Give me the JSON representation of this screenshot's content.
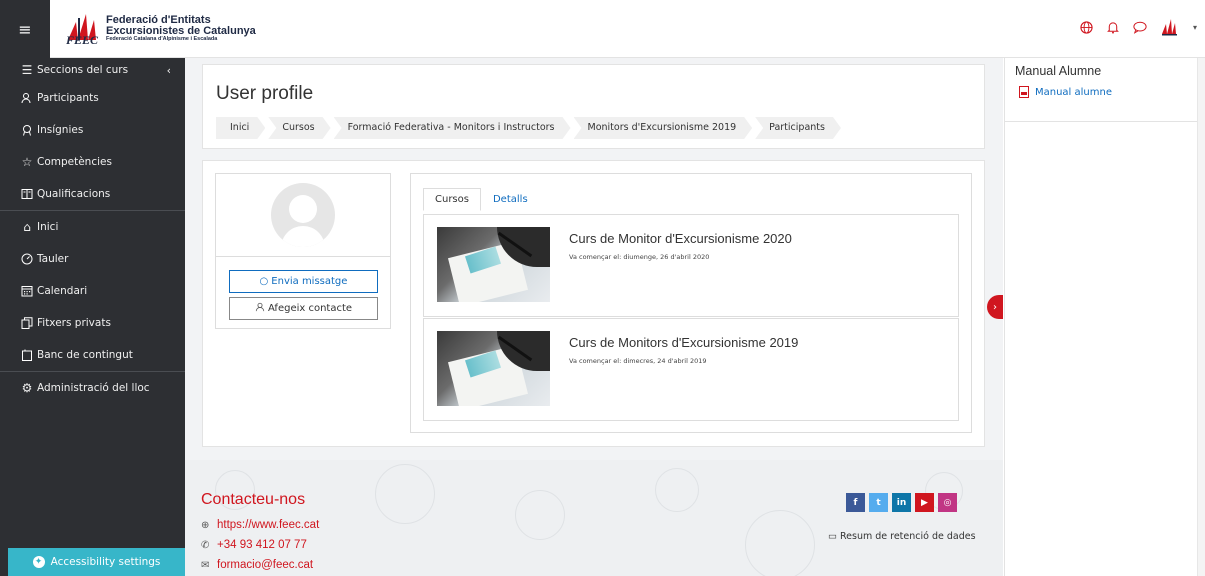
{
  "brand": {
    "line1": "Federació d'Entitats",
    "line2": "Excursionistes de Catalunya",
    "line3": "Federació Catalana d'Alpinisme i Escalada",
    "short": "FEEC",
    "accent": "#d0161f"
  },
  "topbar_icons": [
    "globe-icon",
    "bell-icon",
    "chat-icon",
    "user-menu-logo-icon",
    "caret-down-icon"
  ],
  "sidebar": {
    "items": [
      {
        "label": "Seccions del curs",
        "icon": "list-icon"
      },
      {
        "label": "Participants",
        "icon": "users-icon"
      },
      {
        "label": "Insígnies",
        "icon": "badge-icon"
      },
      {
        "label": "Competències",
        "icon": "star-icon"
      },
      {
        "label": "Qualificacions",
        "icon": "gradebook-icon"
      },
      {
        "label": "Inici",
        "icon": "home-icon"
      },
      {
        "label": "Tauler",
        "icon": "dashboard-icon"
      },
      {
        "label": "Calendari",
        "icon": "calendar-icon"
      },
      {
        "label": "Fitxers privats",
        "icon": "files-icon"
      },
      {
        "label": "Banc de contingut",
        "icon": "content-bank-icon"
      },
      {
        "label": "Administració del lloc",
        "icon": "gear-icon"
      }
    ],
    "accessibility": "Accessibility settings"
  },
  "header": {
    "title": "User profile",
    "breadcrumb": [
      "Inici",
      "Cursos",
      "Formació Federativa - Monitors i Instructors",
      "Monitors d'Excursionisme 2019",
      "Participants"
    ]
  },
  "profile": {
    "message_button": "Envia missatge",
    "contact_button": "Afegeix contacte",
    "tabs": [
      "Cursos",
      "Detalls"
    ],
    "courses": [
      {
        "title": "Curs de Monitor d'Excursionisme 2020",
        "meta": "Va començar el: diumenge, 26 d'abril 2020"
      },
      {
        "title": "Curs de Monitors d'Excursionisme 2019",
        "meta": "Va començar el: dimecres, 24 d'abril 2019"
      }
    ]
  },
  "footer": {
    "contact_title": "Contacteu-nos",
    "web": "https://www.feec.cat",
    "phone": "+34 93 412 07 77",
    "email": "formacio@feec.cat",
    "retention": "Resum de retenció de dades",
    "socials": [
      {
        "name": "facebook",
        "glyph": "f",
        "color": "#3b5998"
      },
      {
        "name": "twitter",
        "glyph": "t",
        "color": "#55acee"
      },
      {
        "name": "linkedin",
        "glyph": "in",
        "color": "#0e76a8"
      },
      {
        "name": "youtube",
        "glyph": "▶",
        "color": "#d0161f"
      },
      {
        "name": "instagram",
        "glyph": "◎",
        "color": "#c13584"
      }
    ]
  },
  "drawer": {
    "block_title": "Manual Alumne",
    "link": "Manual alumne"
  }
}
